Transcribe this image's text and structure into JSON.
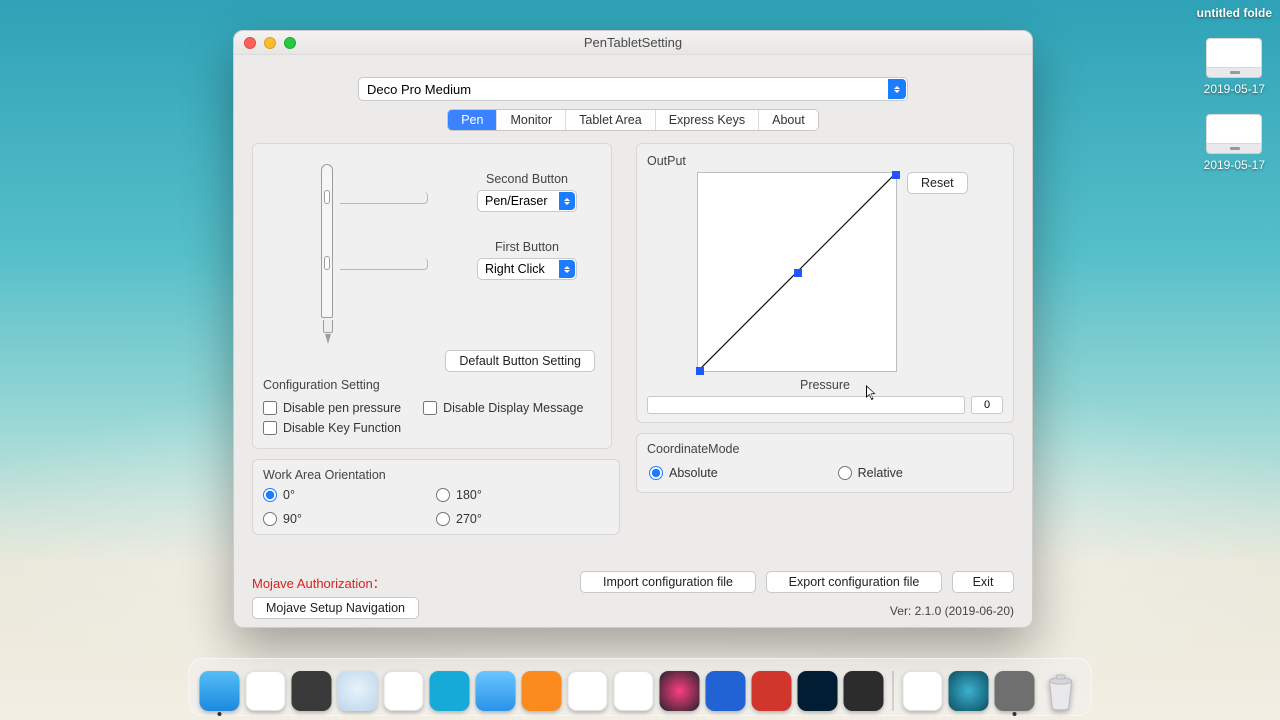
{
  "desktop": {
    "top_label": "untitled folde",
    "drive1": "2019-05-17",
    "drive2": "2019-05-17"
  },
  "window": {
    "title": "PenTabletSetting",
    "device": "Deco Pro Medium",
    "tabs": [
      "Pen",
      "Monitor",
      "Tablet Area",
      "Express Keys",
      "About"
    ],
    "active_tab_index": 0
  },
  "pen_panel": {
    "second_button_label": "Second Button",
    "second_button_value": "Pen/Eraser",
    "first_button_label": "First Button",
    "first_button_value": "Right Click",
    "default_button": "Default  Button Setting"
  },
  "config": {
    "title": "Configuration Setting",
    "disable_pen_pressure": "Disable pen pressure",
    "disable_display_message": "Disable Display Message",
    "disable_key_function": "Disable Key Function"
  },
  "orientation": {
    "title": "Work Area Orientation",
    "options": [
      "0°",
      "180°",
      "90°",
      "270°"
    ],
    "selected": "0°"
  },
  "output": {
    "label": "OutPut",
    "reset": "Reset",
    "pressure_label": "Pressure",
    "pressure_value": "0"
  },
  "coord": {
    "title": "CoordinateMode",
    "absolute": "Absolute",
    "relative": "Relative",
    "selected": "Absolute"
  },
  "footer": {
    "mojave": "Mojave Authorization：",
    "mojave_btn": "Mojave Setup Navigation",
    "import": "Import configuration file",
    "export": "Export configuration file",
    "exit": "Exit",
    "version": "Ver: 2.1.0 (2019-06-20)"
  },
  "chart_data": {
    "type": "line",
    "title": "Pressure curve",
    "xlabel": "Pressure",
    "ylabel": "OutPut",
    "x": [
      0,
      0.5,
      1
    ],
    "y": [
      0,
      0.5,
      1
    ],
    "xlim": [
      0,
      1
    ],
    "ylim": [
      0,
      1
    ]
  }
}
